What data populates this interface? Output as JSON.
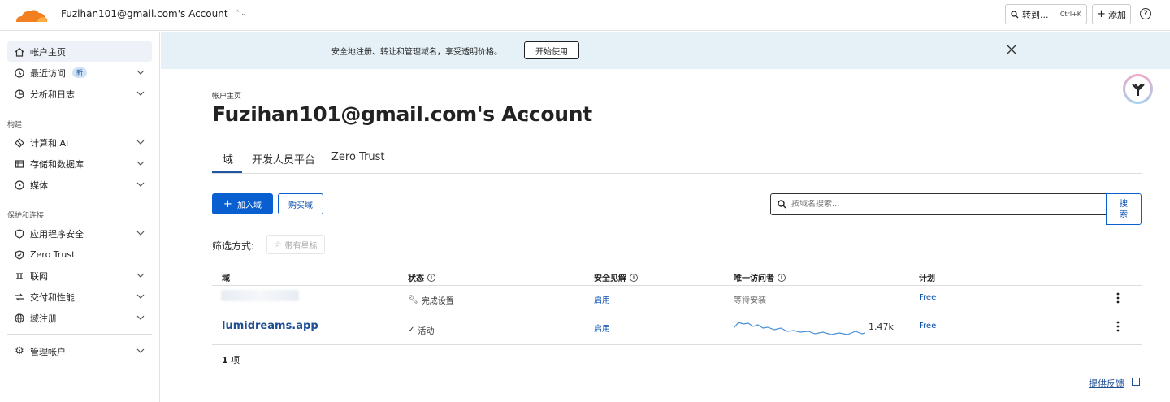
{
  "topbar": {
    "account_name": "Fuzihan101@gmail.com's Account",
    "goto_label": "转到...",
    "goto_shortcut": "Ctrl+K",
    "add_label": "添加",
    "help_symbol": "?"
  },
  "sidebar": {
    "items": [
      {
        "label": "帐户主页",
        "icon": "home-icon"
      },
      {
        "label": "最近访问",
        "icon": "clock-icon",
        "badge": "新"
      },
      {
        "label": "分析和日志",
        "icon": "chart-icon"
      },
      {
        "label": "计算和 AI",
        "icon": "compute-icon"
      },
      {
        "label": "存储和数据库",
        "icon": "storage-icon"
      },
      {
        "label": "媒体",
        "icon": "media-icon"
      },
      {
        "label": "应用程序安全",
        "icon": "shield-icon"
      },
      {
        "label": "Zero Trust",
        "icon": "zero-trust-icon"
      },
      {
        "label": "联网",
        "icon": "network-icon"
      },
      {
        "label": "交付和性能",
        "icon": "delivery-icon"
      },
      {
        "label": "域注册",
        "icon": "globe-icon"
      },
      {
        "label": "管理帐户",
        "icon": "gear-icon"
      }
    ],
    "sections": {
      "build": "构建",
      "protect": "保护和连接"
    }
  },
  "banner": {
    "text": "安全地注册、转让和管理域名，享受透明价格。",
    "button": "开始使用"
  },
  "main": {
    "breadcrumb": "帐户主页",
    "title": "Fuzihan101@gmail.com's Account",
    "tabs": [
      {
        "label": "域"
      },
      {
        "label": "开发人员平台"
      },
      {
        "label": "Zero Trust"
      }
    ],
    "add_domain": "加入域",
    "buy_domain": "购买域",
    "search_placeholder": "按域名搜索...",
    "search_button": "搜索",
    "filter_label": "筛选方式:",
    "filter_starred": "带有星标"
  },
  "table": {
    "headers": {
      "domain": "域",
      "status": "状态",
      "insights": "安全见解",
      "visitors": "唯一访问者",
      "plan": "计划"
    },
    "rows": [
      {
        "domain": "",
        "status": "完成设置",
        "insights": "启用",
        "visitors": "等待安装",
        "plan": "Free"
      },
      {
        "domain": "lumidreams.app",
        "status": "活动",
        "insights": "启用",
        "visitors": "1.47k",
        "plan": "Free"
      }
    ],
    "count_number": "1",
    "count_unit": "项"
  },
  "footer": {
    "feedback": "提供反馈"
  },
  "colors": {
    "accent": "#0a5fd0",
    "banner_bg": "#e6f1f7",
    "logo_orange": "#f38020"
  }
}
